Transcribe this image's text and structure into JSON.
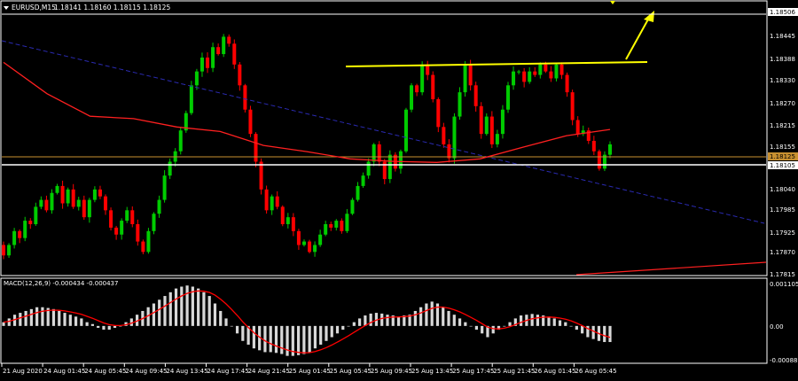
{
  "header": {
    "symbol": "EURUSD,M15",
    "ohlc": "1.18141 1.18160 1.18115 1.18125"
  },
  "price_axis": {
    "ticks": [
      "1.18506",
      "1.18445",
      "1.18388",
      "1.18330",
      "1.18270",
      "1.18215",
      "1.18155",
      "1.18100",
      "1.18040",
      "1.17985",
      "1.17925",
      "1.17870",
      "1.17815"
    ],
    "current_price": "1.18125",
    "bid_line": "1.18105"
  },
  "macd": {
    "label": "MACD(12,26,9) -0.000434 -0.000437",
    "ticks": [
      "0.001105",
      "0.00",
      "-0.000881"
    ]
  },
  "time_axis": {
    "labels": [
      "21 Aug 2020",
      "24 Aug 01:45",
      "24 Aug 05:45",
      "24 Aug 09:45",
      "24 Aug 13:45",
      "24 Aug 17:45",
      "24 Aug 21:45",
      "25 Aug 01:45",
      "25 Aug 05:45",
      "25 Aug 09:45",
      "25 Aug 13:45",
      "25 Aug 17:45",
      "25 Aug 21:45",
      "26 Aug 01:45",
      "26 Aug 05:45"
    ]
  },
  "colors": {
    "background": "#000000",
    "bull": "#00cc00",
    "bear": "#ff0000",
    "ma": "#ff2020",
    "trend_blue": "#2a2ab0",
    "resistance": "#ffff00",
    "price_line": "#c89030",
    "bid_line": "#ffffff",
    "macd_hist": "#d8d8d8",
    "macd_signal": "#ff0000"
  },
  "chart_data": {
    "type": "candlestick",
    "title": "EURUSD,M15",
    "ylim": [
      1.178,
      1.18525
    ],
    "macd_ylim": [
      -0.00095,
      0.00118
    ],
    "closes": [
      1.1783,
      1.1786,
      1.179,
      1.1788,
      1.1793,
      1.1792,
      1.1797,
      1.1799,
      1.1796,
      1.1801,
      1.1803,
      1.1798,
      1.1802,
      1.1797,
      1.1799,
      1.1794,
      1.1799,
      1.1802,
      1.18,
      1.1796,
      1.1791,
      1.1789,
      1.1793,
      1.1796,
      1.1792,
      1.1787,
      1.1784,
      1.179,
      1.1795,
      1.1799,
      1.1806,
      1.181,
      1.1813,
      1.1819,
      1.1824,
      1.1832,
      1.1836,
      1.184,
      1.1837,
      1.1843,
      1.1841,
      1.1846,
      1.1844,
      1.1838,
      1.1832,
      1.1825,
      1.1818,
      1.181,
      1.1802,
      1.1796,
      1.18,
      1.1797,
      1.1792,
      1.1794,
      1.179,
      1.1786,
      1.1787,
      1.1784,
      1.1786,
      1.1789,
      1.1792,
      1.1791,
      1.1793,
      1.179,
      1.1795,
      1.1799,
      1.1803,
      1.1806,
      1.181,
      1.1815,
      1.181,
      1.1805,
      1.1812,
      1.1808,
      1.1813,
      1.1825,
      1.1832,
      1.183,
      1.1838,
      1.1835,
      1.1828,
      1.182,
      1.1815,
      1.1811,
      1.1823,
      1.183,
      1.1838,
      1.1832,
      1.1826,
      1.1818,
      1.1823,
      1.1815,
      1.1818,
      1.1825,
      1.1832,
      1.1836,
      1.1836,
      1.1833,
      1.1836,
      1.1835,
      1.1838,
      1.1836,
      1.1834,
      1.1838,
      1.1835,
      1.183,
      1.1822,
      1.1818,
      1.1819,
      1.1816,
      1.1813,
      1.1808,
      1.1812,
      1.1815
    ],
    "opens": [
      1.1786,
      1.1783,
      1.1786,
      1.179,
      1.1788,
      1.1793,
      1.1792,
      1.1797,
      1.1799,
      1.1796,
      1.1801,
      1.1803,
      1.1798,
      1.1802,
      1.1797,
      1.1799,
      1.1794,
      1.1799,
      1.1802,
      1.18,
      1.1796,
      1.1791,
      1.1789,
      1.1793,
      1.1796,
      1.1792,
      1.1787,
      1.1784,
      1.179,
      1.1795,
      1.1799,
      1.1806,
      1.181,
      1.1813,
      1.1819,
      1.1824,
      1.1832,
      1.1836,
      1.184,
      1.1837,
      1.1843,
      1.1841,
      1.1846,
      1.1844,
      1.1838,
      1.1832,
      1.1825,
      1.1818,
      1.181,
      1.1802,
      1.1796,
      1.18,
      1.1797,
      1.1792,
      1.1794,
      1.179,
      1.1786,
      1.1787,
      1.1784,
      1.1786,
      1.1789,
      1.1792,
      1.1791,
      1.1793,
      1.179,
      1.1795,
      1.1799,
      1.1803,
      1.1806,
      1.181,
      1.1815,
      1.181,
      1.1805,
      1.1812,
      1.1808,
      1.1813,
      1.1825,
      1.1832,
      1.183,
      1.1838,
      1.1835,
      1.1828,
      1.182,
      1.1815,
      1.1811,
      1.1823,
      1.183,
      1.1838,
      1.1832,
      1.1826,
      1.1818,
      1.1823,
      1.1815,
      1.1818,
      1.1825,
      1.1832,
      1.1836,
      1.1836,
      1.1833,
      1.1836,
      1.1835,
      1.1838,
      1.1836,
      1.1834,
      1.1838,
      1.1835,
      1.183,
      1.1822,
      1.1818,
      1.1819,
      1.1816,
      1.1813,
      1.1808,
      1.1812
    ],
    "ma": [
      [
        1.1843,
        1.18386
      ],
      [
        1.1825,
        1.18296
      ],
      [
        1.1818,
        1.18231
      ],
      [
        1.1818,
        1.18224
      ],
      [
        1.1815,
        1.182
      ],
      [
        1.1813,
        1.18187
      ],
      [
        1.1812,
        1.18147
      ],
      [
        1.1813,
        1.18129
      ],
      [
        1.1814,
        1.18108
      ],
      [
        1.1816,
        1.18101
      ],
      [
        1.1818,
        1.18098
      ],
      [
        1.1819,
        1.18108
      ],
      [
        1.182,
        1.18142
      ],
      [
        1.182,
        1.18175
      ],
      [
        1.1821,
        1.18193
      ]
    ],
    "macd_hist": [
      0.0001,
      0.0002,
      0.0003,
      0.00035,
      0.0004,
      0.00045,
      0.0005,
      0.0005,
      0.00048,
      0.00045,
      0.0004,
      0.00035,
      0.0003,
      0.00025,
      0.0002,
      0.0001,
      5e-05,
      -5e-05,
      -0.0001,
      -0.0001,
      -5e-05,
      0.0,
      0.0001,
      0.0002,
      0.0003,
      0.0004,
      0.0005,
      0.0006,
      0.0007,
      0.0008,
      0.0009,
      0.001,
      0.00105,
      0.00108,
      0.00105,
      0.001,
      0.0009,
      0.0008,
      0.0006,
      0.0004,
      0.0002,
      0.0,
      -0.0002,
      -0.0004,
      -0.0005,
      -0.0006,
      -0.00065,
      -0.0007,
      -0.0007,
      -0.00072,
      -0.00075,
      -0.0008,
      -0.0008,
      -0.00078,
      -0.00075,
      -0.0007,
      -0.0006,
      -0.0005,
      -0.0004,
      -0.0003,
      -0.0002,
      -0.0001,
      0.0,
      0.0001,
      0.0002,
      0.00028,
      0.00033,
      0.00035,
      0.00033,
      0.0003,
      0.00028,
      0.00025,
      0.00028,
      0.0003,
      0.0004,
      0.0005,
      0.0006,
      0.00065,
      0.0006,
      0.0005,
      0.0004,
      0.0003,
      0.0002,
      0.0001,
      0.0,
      -0.0001,
      -0.0002,
      -0.0003,
      -0.0002,
      -0.0001,
      0.0,
      0.0001,
      0.0002,
      0.00028,
      0.0003,
      0.00032,
      0.0003,
      0.00028,
      0.00025,
      0.0002,
      0.00015,
      0.0001,
      0.0,
      -0.0001,
      -0.0002,
      -0.0003,
      -0.00035,
      -0.0004,
      -0.00043,
      -0.00043
    ]
  }
}
